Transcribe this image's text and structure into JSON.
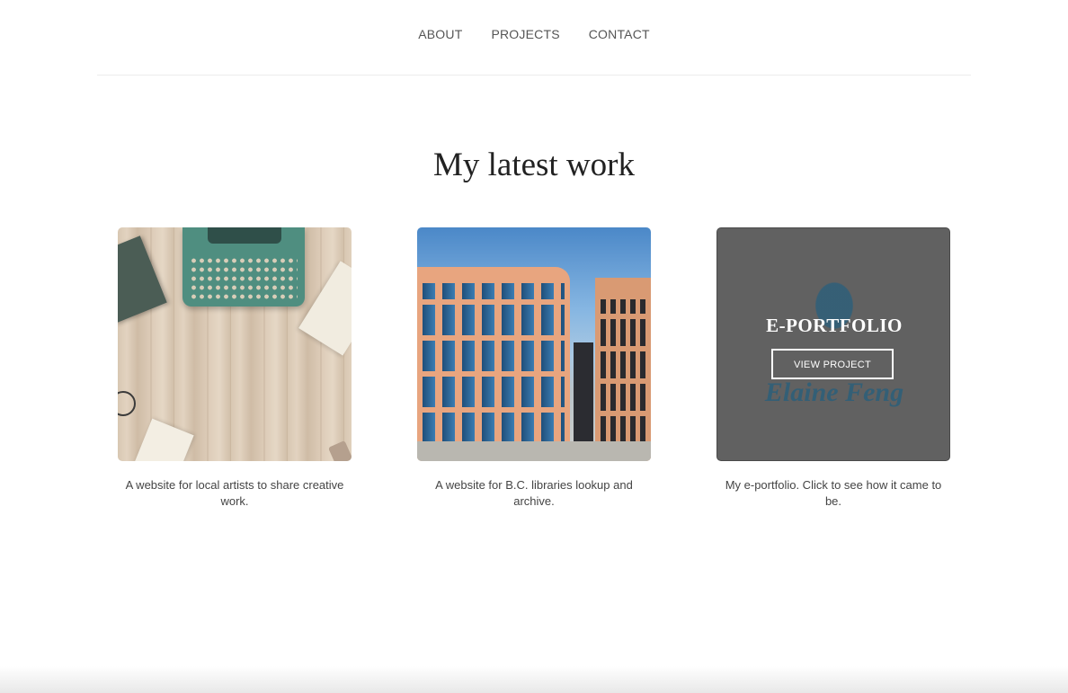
{
  "nav": {
    "items": [
      {
        "label": "ABOUT"
      },
      {
        "label": "PROJECTS"
      },
      {
        "label": "CONTACT"
      }
    ]
  },
  "section": {
    "title": "My latest work"
  },
  "projects": [
    {
      "caption": "A website for local artists to share creative work."
    },
    {
      "caption": "A website for B.C. libraries lookup and archive."
    },
    {
      "caption": "My e-portfolio. Click to see how it came to be.",
      "overlay_title": "E-PORTFOLIO",
      "overlay_button": "VIEW PROJECT",
      "logo_text": "Elaine Feng"
    }
  ],
  "colors": {
    "overlay": "#616161",
    "logo": "#2f5f79",
    "nav_text": "#555555",
    "heading": "#222222"
  }
}
